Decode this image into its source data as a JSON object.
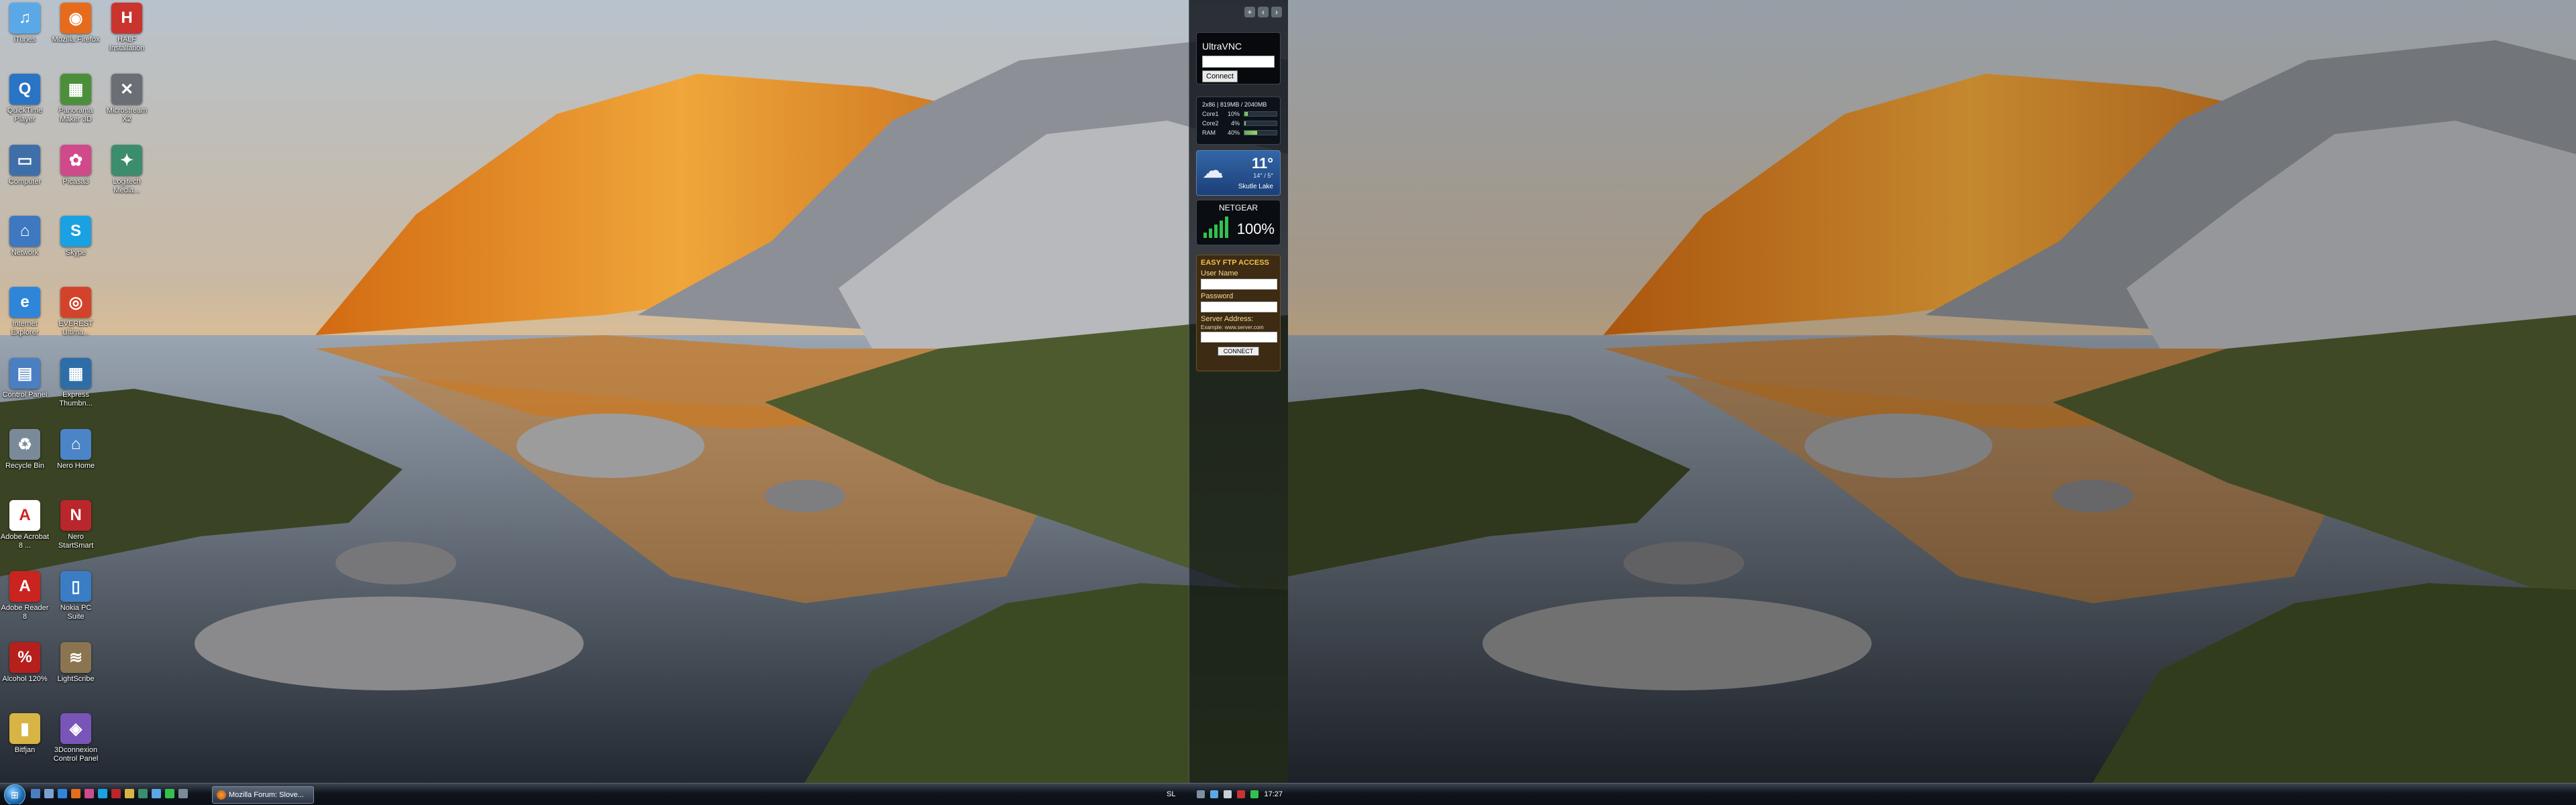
{
  "desktop": {
    "icons": [
      {
        "label": "iTunes",
        "color": "#5aa9e6",
        "glyph": "♫"
      },
      {
        "label": "Mozilla Firefox",
        "color": "#e66b1c",
        "glyph": "◉"
      },
      {
        "label": "HALF Installation",
        "color": "#c9342f",
        "glyph": "H"
      },
      {
        "label": "QuickTime Player",
        "color": "#2a74c5",
        "glyph": "Q"
      },
      {
        "label": "Panorama Maker 3D",
        "color": "#4b8f3a",
        "glyph": "▦"
      },
      {
        "label": "Microstream X2",
        "color": "#6a6f76",
        "glyph": "✕"
      },
      {
        "label": "Computer",
        "color": "#3f6fa8",
        "glyph": "▭"
      },
      {
        "label": "Picasa3",
        "color": "#d04a8b",
        "glyph": "✿"
      },
      {
        "label": "Logitech Media...",
        "color": "#3c8c6e",
        "glyph": "✦"
      },
      {
        "label": "Network",
        "color": "#3d78c0",
        "glyph": "⌂"
      },
      {
        "label": "Skype",
        "color": "#1aa1e1",
        "glyph": "S"
      },
      {
        "label": "Internet Explorer",
        "color": "#2f86d9",
        "glyph": "e"
      },
      {
        "label": "EVEREST Ultima...",
        "color": "#d3432b",
        "glyph": "◎"
      },
      {
        "label": "Control Panel",
        "color": "#4a7fc1",
        "glyph": "▤"
      },
      {
        "label": "Express Thumbn...",
        "color": "#2d6ea8",
        "glyph": "▦"
      },
      {
        "label": "Recycle Bin",
        "color": "#7b8a99",
        "glyph": "♻"
      },
      {
        "label": "Nero Home",
        "color": "#4b84c7",
        "glyph": "⌂"
      },
      {
        "label": "Adobe Acrobat 8 ...",
        "color": "#c9241f",
        "glyph": "A"
      },
      {
        "label": "Nero StartSmart",
        "color": "#b9262b",
        "glyph": "N"
      },
      {
        "label": "Adobe Reader 8",
        "color": "#c9241f",
        "glyph": "A"
      },
      {
        "label": "Nokia PC Suite",
        "color": "#3a7dc4",
        "glyph": "▯"
      },
      {
        "label": "Alcohol 120%",
        "color": "#b5201d",
        "glyph": "%"
      },
      {
        "label": "LightScribe",
        "color": "#8a7550",
        "glyph": "≋"
      },
      {
        "label": "Bitfjan",
        "color": "#d8b445",
        "glyph": "▮"
      },
      {
        "label": "3Dconnexion Control Panel",
        "color": "#7a55b8",
        "glyph": "◈"
      }
    ]
  },
  "sidebar": {
    "controls": [
      "+",
      "‹",
      "›"
    ],
    "ultravnc": {
      "title": "UltraVNC",
      "host_value": "",
      "connect_label": "Connect"
    },
    "cpu": {
      "header": "2x86 | 819MB / 2040MB",
      "rows": [
        {
          "name": "Core1",
          "pct": "10%",
          "level": 0.1
        },
        {
          "name": "Core2",
          "pct": "4%",
          "level": 0.04
        },
        {
          "name": "RAM",
          "pct": "40%",
          "level": 0.4
        }
      ]
    },
    "weather": {
      "temp": "11°",
      "range": "14° / 5°",
      "location": "Skutle Lake"
    },
    "network": {
      "brand": "NETGEAR",
      "signal": "100%"
    },
    "ftp": {
      "title": "EASY FTP ACCESS",
      "username_label": "User Name",
      "password_label": "Password",
      "server_label": "Server Address:",
      "example": "Example: www.server.com",
      "connect_label": "CONNECT"
    }
  },
  "taskbar": {
    "start_label": "⊞",
    "task_button": "Mozilla Forum: Slove...",
    "lang": "SL",
    "clock": "17:27"
  }
}
